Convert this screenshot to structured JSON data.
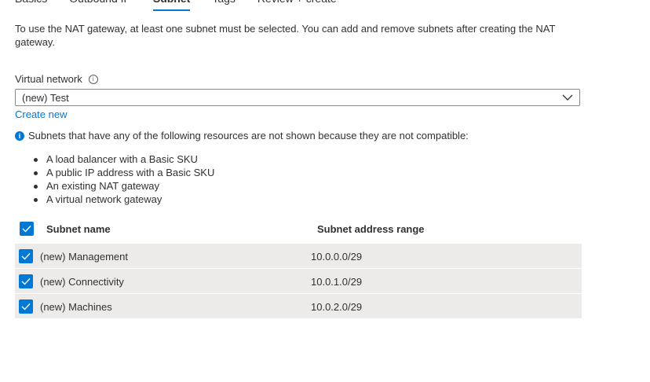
{
  "tabs": [
    {
      "label": "Basics"
    },
    {
      "label": "Outbound IP"
    },
    {
      "label": "Subnet",
      "active": true
    },
    {
      "label": "Tags"
    },
    {
      "label": "Review + create"
    }
  ],
  "intro": "To use the NAT gateway, at least one subnet must be selected. You can add and remove subnets after creating the NAT gateway.",
  "virtual_network": {
    "label": "Virtual network",
    "selected": "(new) Test",
    "create_new": "Create new"
  },
  "notice": {
    "text": "Subnets that have any of the following resources are not shown because they are not compatible:",
    "items": [
      "A load balancer with a Basic SKU",
      "A public IP address with a Basic SKU",
      "An existing NAT gateway",
      "A virtual network gateway"
    ]
  },
  "table": {
    "headers": {
      "name": "Subnet name",
      "range": "Subnet address range"
    },
    "select_all_checked": true,
    "rows": [
      {
        "name": "(new) Management",
        "range": "10.0.0.0/29",
        "checked": true
      },
      {
        "name": "(new) Connectivity",
        "range": "10.0.1.0/29",
        "checked": true
      },
      {
        "name": "(new) Machines",
        "range": "10.0.2.0/29",
        "checked": true
      }
    ]
  },
  "colors": {
    "accent": "#0078d4",
    "row_bg": "#edebe9",
    "text": "#323130"
  }
}
